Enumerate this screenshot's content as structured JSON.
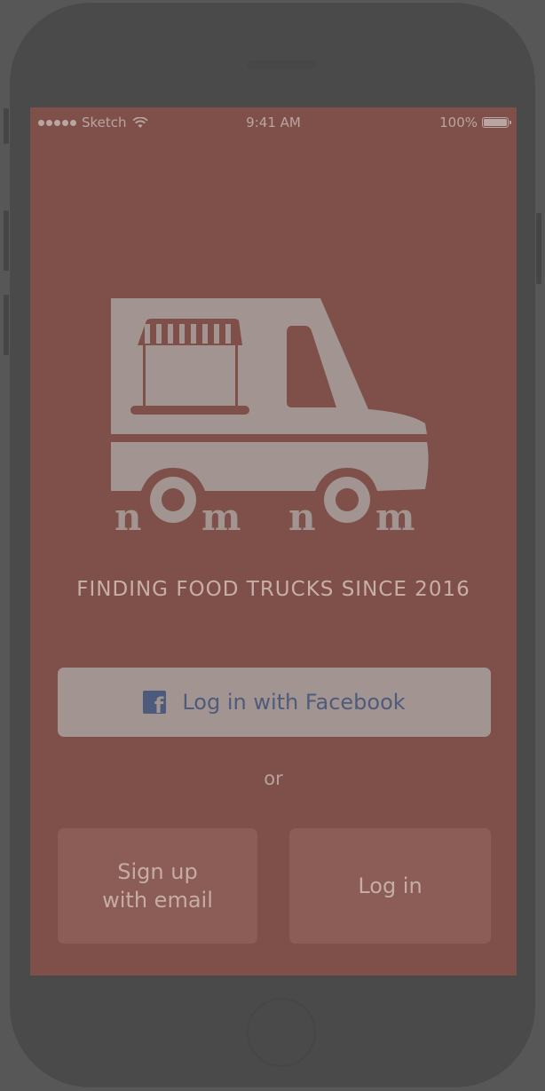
{
  "status_bar": {
    "carrier": "Sketch",
    "time": "9:41 AM",
    "battery": "100%"
  },
  "logo": {
    "wordmark_left": "nOm",
    "wordmark_right": "nOm",
    "icon": "food-truck-icon"
  },
  "tagline": "FINDING FOOD TRUCKS SINCE 2016",
  "facebook_button": {
    "label": "Log in with Facebook",
    "icon": "facebook-icon",
    "icon_color": "#4e5a7c"
  },
  "separator": "or",
  "signup_button": {
    "line1": "Sign up",
    "line2": "with email"
  },
  "login_button": {
    "label": "Log in"
  },
  "colors": {
    "screen_background": "#7e5049",
    "logo": "#a29491",
    "facebook_button": "#a29491",
    "secondary_button": "#8b5d56"
  }
}
